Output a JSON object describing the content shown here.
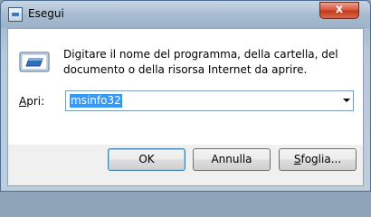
{
  "window": {
    "title": "Esegui",
    "close_glyph": "x"
  },
  "dialog": {
    "icon": "run-dialog-icon",
    "prompt": "Digitare il nome del programma, della cartella, del documento o della risorsa Internet da aprire.",
    "open_label_accel": "A",
    "open_label_rest": "pri:",
    "open_value": "msinfo32"
  },
  "buttons": {
    "ok": "OK",
    "cancel": "Annulla",
    "browse_accel": "S",
    "browse_rest": "foglia..."
  },
  "colors": {
    "selection": "#3399ff",
    "close_button": "#c23a1f",
    "default_button_border": "#3c7fb1"
  }
}
